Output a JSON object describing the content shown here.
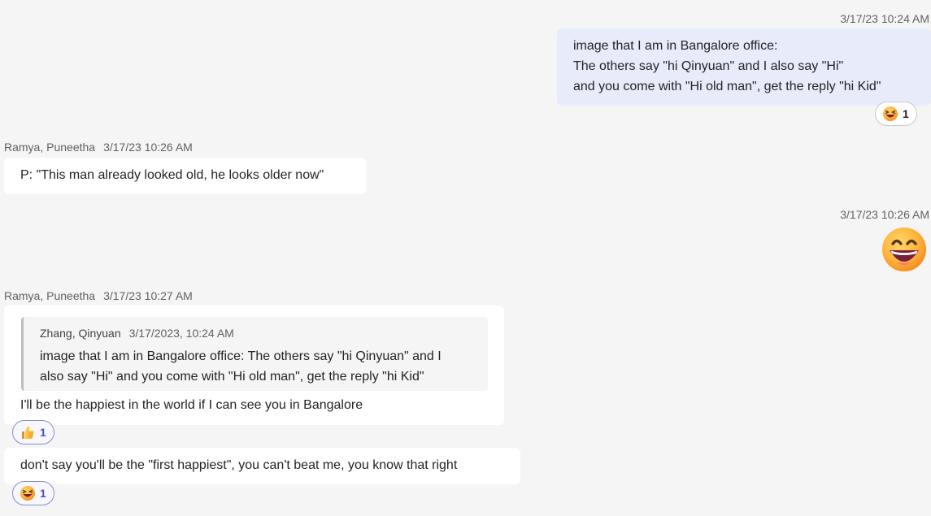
{
  "messages": [
    {
      "timestamp": "3/17/23 10:24 AM",
      "lines": [
        "image that I am in Bangalore office:",
        "The others say \"hi Qinyuan\" and I also say \"Hi\"",
        "and you come with \"Hi old man\", get the reply \"hi Kid\""
      ],
      "reaction": {
        "icon": "laughing-face-icon",
        "count": "1"
      }
    },
    {
      "author": "Ramya, Puneetha",
      "timestamp": "3/17/23 10:26 AM",
      "text": "P: \"This man already looked old, he looks older now\""
    },
    {
      "timestamp": "3/17/23 10:26 AM",
      "emoji": "grinning-face-icon"
    },
    {
      "author": "Ramya, Puneetha",
      "timestamp": "3/17/23 10:27 AM",
      "quote": {
        "author": "Zhang, Qinyuan",
        "timestamp": "3/17/2023, 10:24 AM",
        "lines": [
          "image that I am in Bangalore office: The others say \"hi Qinyuan\" and I",
          "also say \"Hi\" and you come with \"Hi old man\", get the reply \"hi Kid\""
        ]
      },
      "text": "I'll be the happiest in the world if I can see you in Bangalore",
      "reaction": {
        "icon": "thumbs-up-icon",
        "count": "1"
      }
    },
    {
      "text": "don't say you'll be the \"first happiest\", you can't beat me, you know that right",
      "reaction": {
        "icon": "laughing-face-icon",
        "count": "1"
      }
    }
  ],
  "colors": {
    "background": "#f5f5f5",
    "outgoing_bubble": "#e8ebfa",
    "incoming_bubble": "#ffffff",
    "reaction_active_border": "#8b8cc7",
    "reaction_active_text": "#4f52b2"
  }
}
